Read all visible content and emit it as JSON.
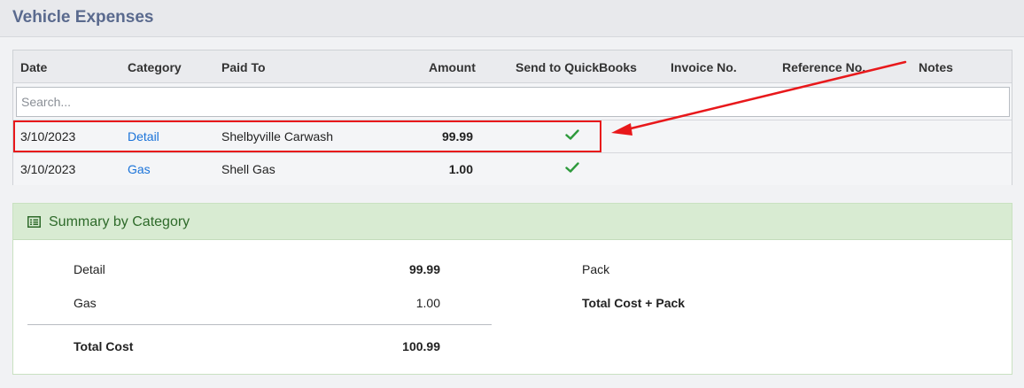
{
  "header": {
    "title": "Vehicle Expenses"
  },
  "grid": {
    "columns": [
      "Date",
      "Category",
      "Paid To",
      "Amount",
      "Send to QuickBooks",
      "Invoice No.",
      "Reference No.",
      "Notes"
    ],
    "search_placeholder": "Search...",
    "rows": [
      {
        "date": "3/10/2023",
        "category": "Detail",
        "paid_to": "Shelbyville Carwash",
        "amount": "99.99",
        "send_to_quickbooks": true
      },
      {
        "date": "3/10/2023",
        "category": "Gas",
        "paid_to": "Shell Gas",
        "amount": "1.00",
        "send_to_quickbooks": true
      }
    ]
  },
  "summary": {
    "title": "Summary by Category",
    "items": [
      {
        "label": "Detail",
        "value": "99.99"
      },
      {
        "label": "Gas",
        "value": "1.00"
      }
    ],
    "total_label": "Total Cost",
    "total_value": "100.99",
    "pack_label": "Pack",
    "total_pack_label": "Total Cost + Pack"
  },
  "colors": {
    "title": "#5a6a8e",
    "link": "#1a73d9",
    "check": "#2e9a3c",
    "annotation": "#e8181b",
    "summary_header_bg": "#d8ebd2",
    "summary_title": "#2e6a2a"
  },
  "icons": {
    "check": "check-icon",
    "summary": "list-icon"
  }
}
